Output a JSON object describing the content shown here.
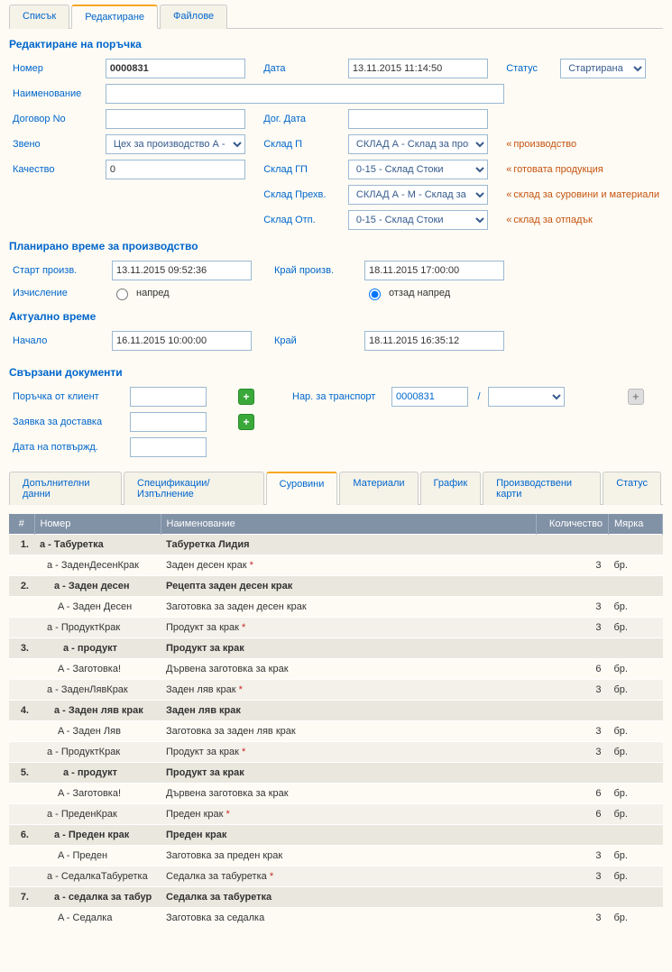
{
  "topTabs": {
    "list": "Списък",
    "edit": "Редактиране",
    "files": "Файлове"
  },
  "sectionTitles": {
    "edit": "Редактиране на поръчка",
    "planned": "Планирано време за производство",
    "actual": "Актуално време",
    "related": "Свързани документи"
  },
  "labels": {
    "number": "Номер",
    "name": "Наименование",
    "contract": "Договор No",
    "unit": "Звено",
    "quality": "Качество",
    "date": "Дата",
    "contractDate": "Дог. Дата",
    "warehouseP": "Склад П",
    "warehouseGP": "Склад ГП",
    "warehousePrehv": "Склад Прехв.",
    "warehouseOtp": "Склад Отп.",
    "status": "Статус",
    "startProd": "Старт произв.",
    "endProd": "Край произв.",
    "calc": "Изчисление",
    "start": "Начало",
    "end": "Край",
    "orderClient": "Поръчка от клиент",
    "deliveryReq": "Заявка за доставка",
    "confirmDate": "Дата на потвържд.",
    "transportOrder": "Нар. за транспорт"
  },
  "values": {
    "number": "0000831",
    "date": "13.11.2015 11:14:50",
    "status": "Стартирана",
    "unit": "Цех за производство А - Мебел",
    "quality": "0",
    "warehouseP": "СКЛАД А - Склад за производс",
    "warehouseGP": "0-15 - Склад Стоки",
    "warehousePrehv": "СКЛАД А - М - Склад за матери",
    "warehouseOtp": "0-15 - Склад Стоки",
    "startProd": "13.11.2015 09:52:36",
    "endProd": "18.11.2015 17:00:00",
    "radioForward": "напред",
    "radioBackForward": "отзад напред",
    "actualStart": "16.11.2015 10:00:00",
    "actualEnd": "18.11.2015 16:35:12",
    "transportNumber": "0000831",
    "slash": "/"
  },
  "hints": {
    "production": "производство",
    "finishedGoods": "готовата продукция",
    "rawMaterials": "склад за суровини и материали",
    "waste": "склад за отпадък"
  },
  "subTabs": {
    "extra": "Допълнителни данни",
    "specs": "Спецификации/Изпълнение",
    "raw": "Суровини",
    "materials": "Материали",
    "schedule": "График",
    "prodCards": "Производствени карти",
    "status": "Статус"
  },
  "headers": {
    "idx": "#",
    "number": "Номер",
    "name": "Наименование",
    "qty": "Количество",
    "unit": "Мярка"
  },
  "rows": [
    {
      "type": "group",
      "idx": "1.",
      "code": "a - Табуретка",
      "name": "Табуретка Лидия"
    },
    {
      "type": "reg",
      "code": "a - ЗаденДесенКрак",
      "name": "Заден десен крак",
      "star": true,
      "qty": "3",
      "unit": "бр."
    },
    {
      "type": "group",
      "idx": "2.",
      "code": "a - Заден десен",
      "name": "Рецепта заден десен крак"
    },
    {
      "type": "reg",
      "code": "A - Заден Десен",
      "name": "Заготовка за заден десен крак",
      "qty": "3",
      "unit": "бр."
    },
    {
      "type": "alt",
      "code": "a - ПродуктКрак",
      "name": "Продукт за крак",
      "star": true,
      "qty": "3",
      "unit": "бр."
    },
    {
      "type": "group",
      "idx": "3.",
      "code": "a - продукт",
      "name": "Продукт за крак"
    },
    {
      "type": "reg",
      "code": "A - Заготовка!",
      "name": "Дървена заготовка за крак",
      "qty": "6",
      "unit": "бр."
    },
    {
      "type": "alt",
      "code": "a - ЗаденЛявКрак",
      "name": "Заден ляв крак",
      "star": true,
      "qty": "3",
      "unit": "бр."
    },
    {
      "type": "group",
      "idx": "4.",
      "code": "a - Заден ляв крак",
      "name": "Заден ляв крак"
    },
    {
      "type": "reg",
      "code": "A - Заден Ляв",
      "name": "Заготовка за заден ляв крак",
      "qty": "3",
      "unit": "бр."
    },
    {
      "type": "alt",
      "code": "a - ПродуктКрак",
      "name": "Продукт за крак",
      "star": true,
      "qty": "3",
      "unit": "бр."
    },
    {
      "type": "group",
      "idx": "5.",
      "code": "a - продукт",
      "name": "Продукт за крак"
    },
    {
      "type": "reg",
      "code": "A - Заготовка!",
      "name": "Дървена заготовка за крак",
      "qty": "6",
      "unit": "бр."
    },
    {
      "type": "alt",
      "code": "a - ПреденКрак",
      "name": "Преден крак",
      "star": true,
      "qty": "6",
      "unit": "бр."
    },
    {
      "type": "group",
      "idx": "6.",
      "code": "a - Преден крак",
      "name": "Преден крак"
    },
    {
      "type": "reg",
      "code": "A - Преден",
      "name": "Заготовка за преден крак",
      "qty": "3",
      "unit": "бр."
    },
    {
      "type": "alt",
      "code": "a - СедалкаТабуретка",
      "name": "Седалка за табуретка",
      "star": true,
      "qty": "3",
      "unit": "бр."
    },
    {
      "type": "group",
      "idx": "7.",
      "code": "a - седалка за табур",
      "name": "Седалка за табуретка"
    },
    {
      "type": "reg",
      "code": "A - Седалка",
      "name": "Заготовка за седалка",
      "qty": "3",
      "unit": "бр."
    }
  ]
}
